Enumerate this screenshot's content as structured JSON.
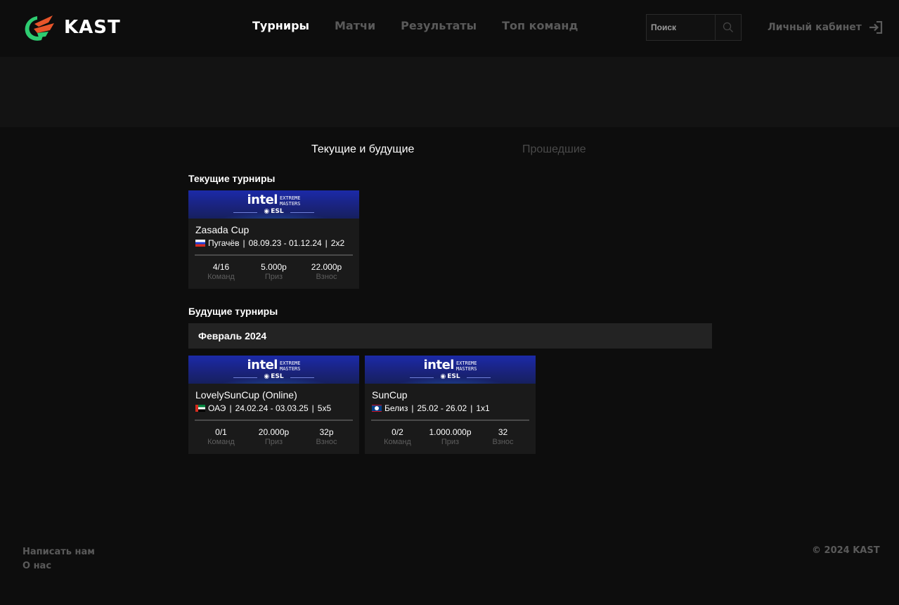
{
  "header": {
    "logo_text": "KAST",
    "nav": [
      {
        "label": "Турниры",
        "active": true
      },
      {
        "label": "Матчи",
        "active": false
      },
      {
        "label": "Результаты",
        "active": false
      },
      {
        "label": "Топ команд",
        "active": false
      }
    ],
    "search_placeholder": "Поиск",
    "account_label": "Личный кабинет",
    "icons": {
      "search": "search-icon",
      "login": "login-arrow-icon",
      "logo": "kast-logo-icon"
    }
  },
  "tabs": {
    "current": "Текущие и будущие",
    "past": "Прошедшие",
    "active": "current"
  },
  "current_section": {
    "title": "Текущие турниры",
    "cards": [
      {
        "banner": {
          "brand": "intel",
          "extreme": "EXTREME",
          "masters": "MASTERS",
          "esl": "ESL"
        },
        "name": "Zasada Cup",
        "flag": "russia-flag",
        "location": "Пугачёв",
        "dates": "08.09.23 - 01.12.24",
        "format": "2x2",
        "teams": "4/16",
        "teams_label": "Команд",
        "prize": "5.000р",
        "prize_label": "Приз",
        "fee": "22.000р",
        "fee_label": "Взнос"
      }
    ]
  },
  "future_section": {
    "title": "Будущие турниры",
    "month": "Февраль 2024",
    "cards": [
      {
        "banner": {
          "brand": "intel",
          "extreme": "EXTREME",
          "masters": "MASTERS",
          "esl": "ESL"
        },
        "name": "LovelySunCup (Online)",
        "flag": "uae-flag",
        "location": "ОАЭ",
        "dates": "24.02.24 - 03.03.25",
        "format": "5x5",
        "teams": "0/1",
        "teams_label": "Команд",
        "prize": "20.000р",
        "prize_label": "Приз",
        "fee": "32р",
        "fee_label": "Взнос"
      },
      {
        "banner": {
          "brand": "intel",
          "extreme": "EXTREME",
          "masters": "MASTERS",
          "esl": "ESL"
        },
        "name": "SunCup",
        "flag": "belize-flag",
        "location": "Белиз",
        "dates": "25.02 - 26.02",
        "format": "1x1",
        "teams": "0/2",
        "teams_label": "Команд",
        "prize": "1.000.000р",
        "prize_label": "Приз",
        "fee": "32",
        "fee_label": "Взнос"
      }
    ]
  },
  "footer": {
    "links": [
      "Написать нам",
      "О нас"
    ],
    "copyright": "© 2024 KAST"
  },
  "colors": {
    "background": "#0d0d0d",
    "card": "#1a1a1a",
    "accent_green": "#2ecc71",
    "accent_orange": "#e8552a",
    "muted": "#5a5a5a"
  }
}
